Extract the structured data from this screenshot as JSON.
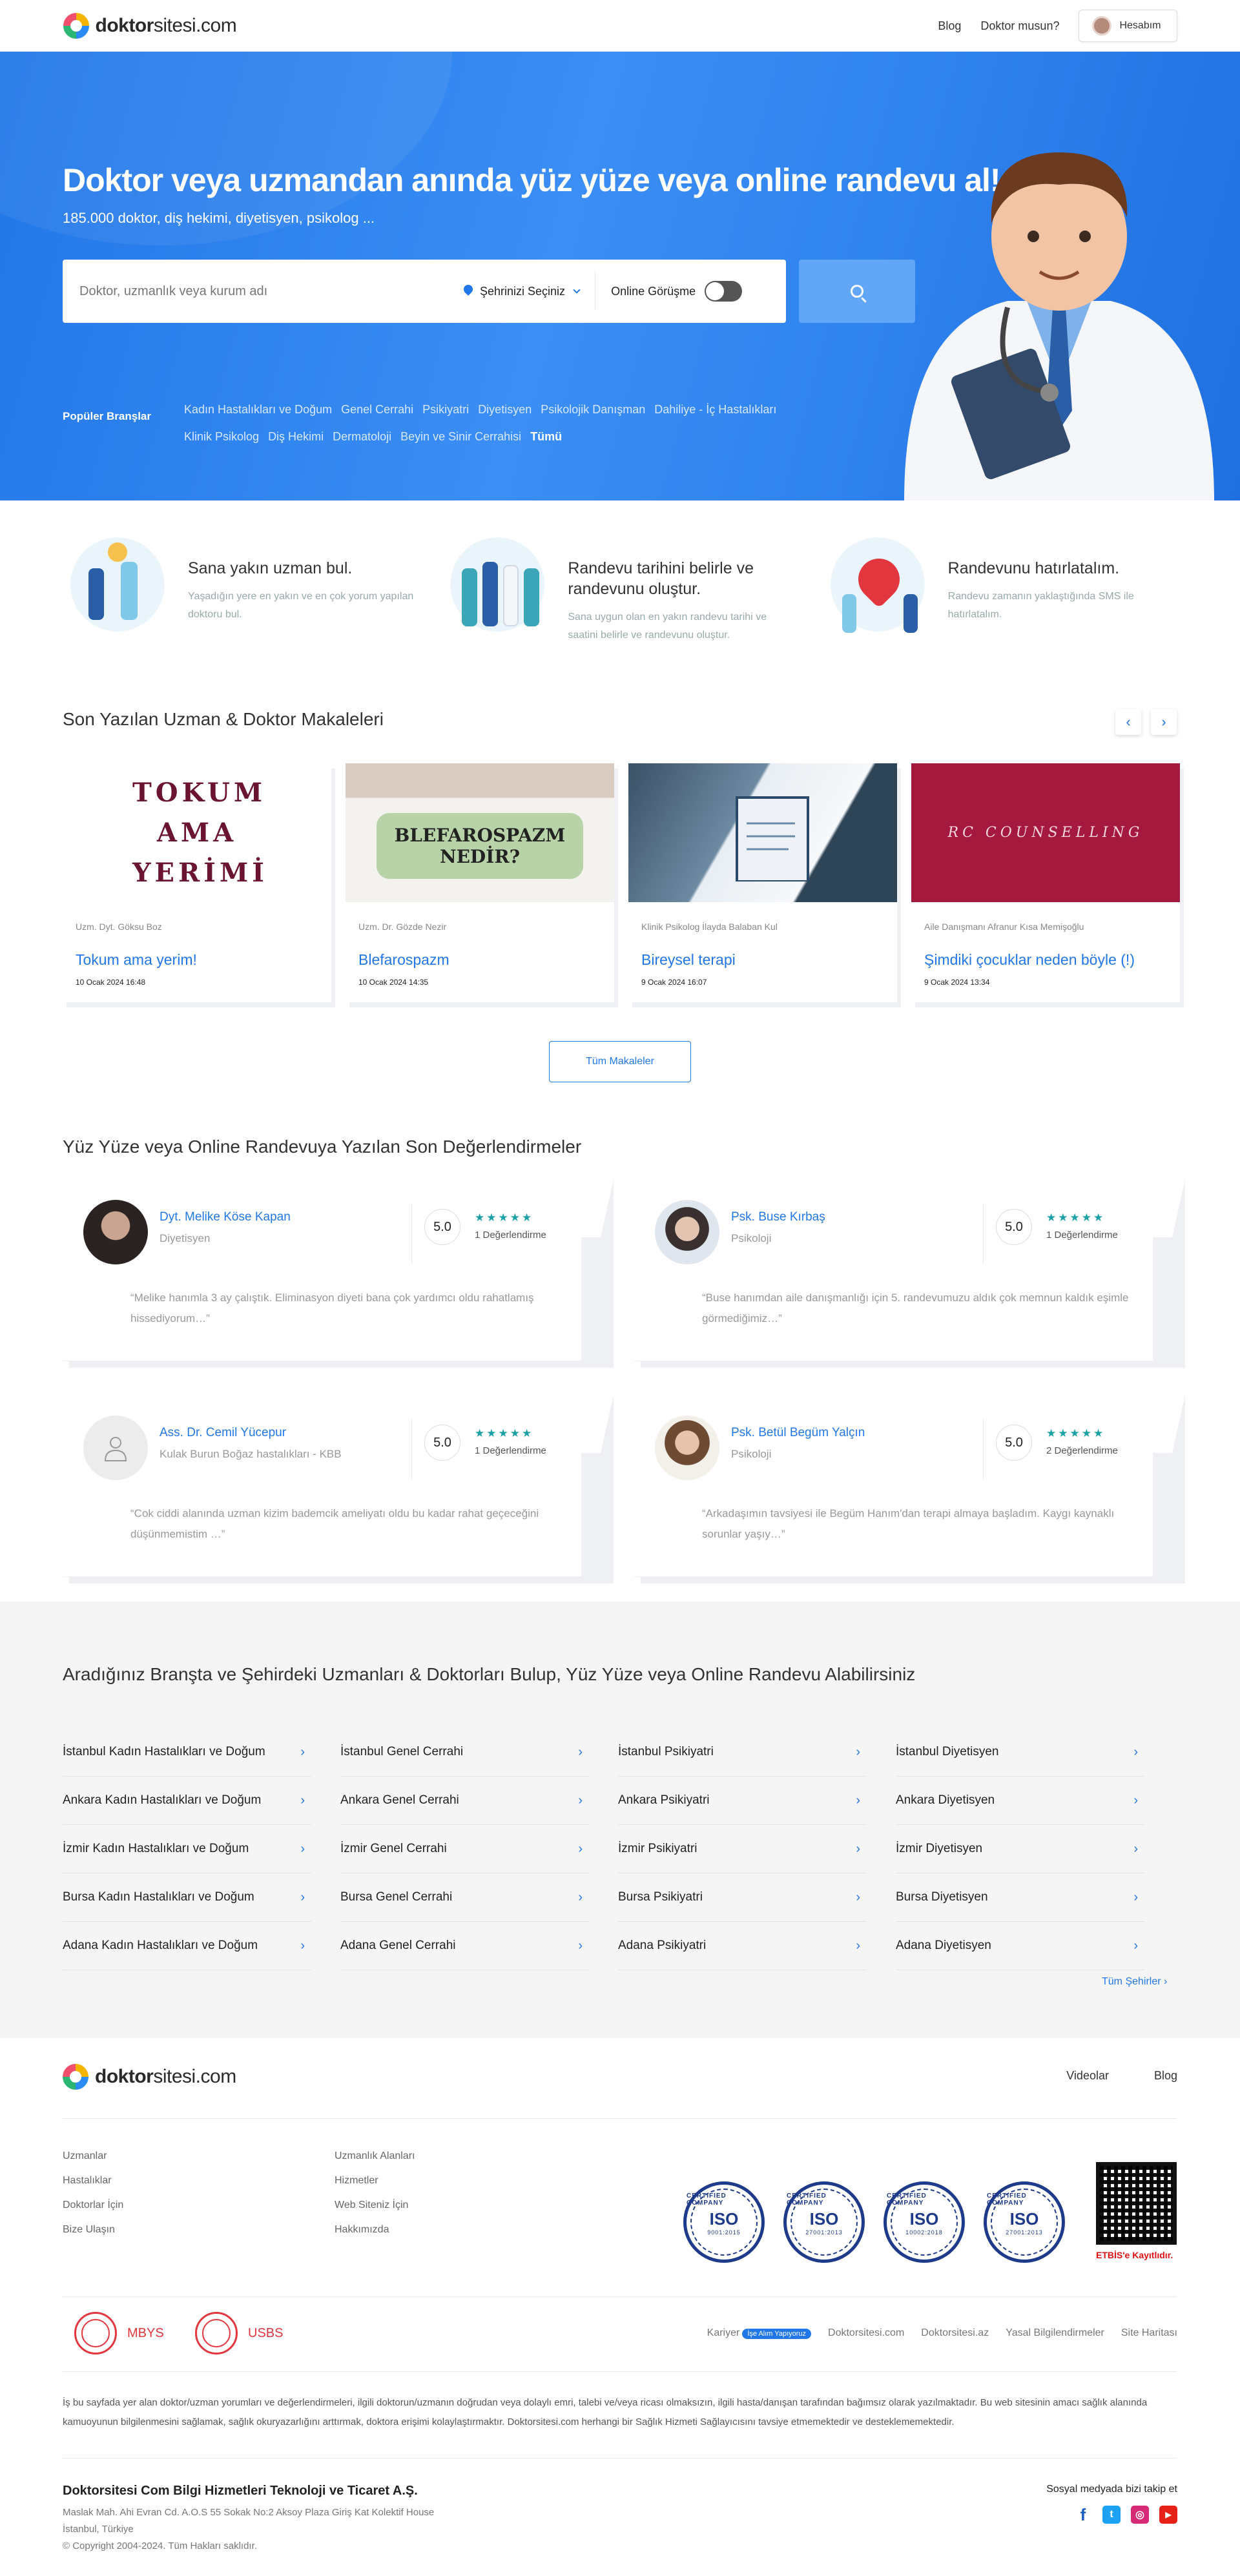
{
  "header": {
    "logo_bold": "doktor",
    "logo_rest": "sitesi.com",
    "nav": [
      "Blog",
      "Doktor musun?"
    ],
    "account_label": "Hesabım"
  },
  "hero": {
    "title": "Doktor veya uzmandan anında yüz yüze veya online randevu al!",
    "subtitle": "185.000 doktor, diş hekimi, diyetisyen, psikolog ...",
    "search_placeholder": "Doktor, uzmanlık veya kurum adı",
    "city_label": "Şehrinizi Seçiniz",
    "online_label": "Online Görüşme",
    "popular_label": "Popüler Branşlar",
    "branches": [
      "Kadın Hastalıkları ve Doğum",
      "Genel Cerrahi",
      "Psikiyatri",
      "Diyetisyen",
      "Psikolojik Danışman",
      "Dahiliye - İç Hastalıkları",
      "Klinik Psikolog",
      "Diş Hekimi",
      "Dermatoloji",
      "Beyin ve Sinir Cerrahisi"
    ],
    "branches_all": "Tümü"
  },
  "features": [
    {
      "title": "Sana yakın uzman bul.",
      "text": "Yaşadığın yere en yakın ve en çok yorum yapılan doktoru bul."
    },
    {
      "title": "Randevu tarihini belirle ve randevunu oluştur.",
      "text": "Sana uygun olan en yakın randevu tarihi ve saatini belirle ve randevunu oluştur."
    },
    {
      "title": "Randevunu hatırlatalım.",
      "text": "Randevu zamanın yaklaştığında SMS ile hatırlatalım."
    }
  ],
  "articles": {
    "title": "Son Yazılan Uzman & Doktor Makaleleri",
    "prev": "‹",
    "next": "›",
    "items": [
      {
        "author": "Uzm. Dyt. Göksu Boz",
        "title": "Tokum ama yerim!",
        "date": "10 Ocak 2024 16:48",
        "img_text": "TOKUM AMA YERİMİ"
      },
      {
        "author": "Uzm. Dr. Gözde Nezir",
        "title": "Blefarospazm",
        "date": "10 Ocak 2024 14:35",
        "img_text": "BLEFAROSPAZM NEDİR?"
      },
      {
        "author": "Klinik Psikolog İlayda Balaban Kul",
        "title": "Bireysel terapi",
        "date": "9 Ocak 2024 16:07",
        "img_text": ""
      },
      {
        "author": "Aile Danışmanı Afranur Kısa Memişoğlu",
        "title": "Şimdiki çocuklar neden böyle (!)",
        "date": "9 Ocak 2024 13:34",
        "img_text": "RC COUNSELLING"
      }
    ],
    "all_button": "Tüm Makaleler"
  },
  "reviews": {
    "title": "Yüz Yüze veya Online Randevuya Yazılan Son Değerlendirmeler",
    "items": [
      {
        "name": "Dyt. Melike Köse Kapan",
        "spec": "Diyetisyen",
        "score": "5.0",
        "stars": "★★★★★",
        "count": "1 Değerlendirme",
        "text": "“Melike hanımla 3 ay çalıştık. Eliminasyon diyeti bana çok yardımcı oldu rahatlamış hissediyorum…”"
      },
      {
        "name": "Psk. Buse Kırbaş",
        "spec": "Psikoloji",
        "score": "5.0",
        "stars": "★★★★★",
        "count": "1 Değerlendirme",
        "text": "“Buse hanımdan aile danışmanlığı için 5. randevumuzu aldık çok memnun kaldık eşimle görmediğimiz…”"
      },
      {
        "name": "Ass. Dr. Cemil Yücepur",
        "spec": "Kulak Burun Boğaz hastalıkları - KBB",
        "score": "5.0",
        "stars": "★★★★★",
        "count": "1 Değerlendirme",
        "text": "“Cok ciddi alanında uzman kizim bademcik ameliyatı oldu bu kadar rahat geçeceğini düşünmemistim …”"
      },
      {
        "name": "Psk. Betül Begüm Yalçın",
        "spec": "Psikoloji",
        "score": "5.0",
        "stars": "★★★★★",
        "count": "2 Değerlendirme",
        "text": "“Arkadaşımın tavsiyesi ile Begüm Hanım'dan terapi almaya başladım. Kaygı kaynaklı sorunlar yaşıy…”"
      }
    ]
  },
  "cities": {
    "title": "Aradığınız Branşta ve Şehirdeki Uzmanları & Doktorları Bulup, Yüz Yüze veya Online Randevu Alabilirsiniz",
    "columns": [
      [
        "İstanbul Kadın Hastalıkları ve Doğum",
        "Ankara Kadın Hastalıkları ve Doğum",
        "İzmir Kadın Hastalıkları ve Doğum",
        "Bursa Kadın Hastalıkları ve Doğum",
        "Adana Kadın Hastalıkları ve Doğum"
      ],
      [
        "İstanbul Genel Cerrahi",
        "Ankara Genel Cerrahi",
        "İzmir Genel Cerrahi",
        "Bursa Genel Cerrahi",
        "Adana Genel Cerrahi"
      ],
      [
        "İstanbul Psikiyatri",
        "Ankara Psikiyatri",
        "İzmir Psikiyatri",
        "Bursa Psikiyatri",
        "Adana Psikiyatri"
      ],
      [
        "İstanbul Diyetisyen",
        "Ankara Diyetisyen",
        "İzmir Diyetisyen",
        "Bursa Diyetisyen",
        "Adana Diyetisyen"
      ]
    ],
    "all_link": "Tüm Şehirler"
  },
  "footer": {
    "nav": [
      "Videolar",
      "Blog"
    ],
    "links_col1": [
      "Uzmanlar",
      "Hastalıklar",
      "Doktorlar İçin",
      "Bize Ulaşın"
    ],
    "links_col2": [
      "Uzmanlık Alanları",
      "Hizmetler",
      "Web Siteniz İçin",
      "Hakkımızda"
    ],
    "iso_label": "ISO",
    "iso_ring": "CERTIFIED COMPANY",
    "iso_codes": [
      "9001:2015",
      "27001:2013",
      "10002:2018",
      "27001:2013"
    ],
    "etbis": "ETBİS'e Kayıtlıdır.",
    "mbys": "MBYS",
    "usbs": "USBS",
    "bottom_links": [
      "Doktorsitesi.com",
      "Doktorsitesi.az",
      "Yasal Bilgilendirmeler",
      "Site Haritası"
    ],
    "career": "Kariyer",
    "career_badge": "İşe Alım Yapıyoruz",
    "disclaimer": "İş bu sayfada yer alan doktor/uzman yorumları ve değerlendirmeleri, ilgili doktorun/uzmanın doğrudan veya dolaylı emri, talebi ve/veya ricası olmaksızın, ilgili hasta/danışan tarafından bağımsız olarak yazılmaktadır. Bu web sitesinin amacı sağlık alanında kamuoyunun bilgilenmesini sağlamak, sağlık okuryazarlığını arttırmak, doktora erişimi kolaylaştırmaktır. Doktorsitesi.com herhangi bir Sağlık Hizmeti Sağlayıcısını tavsiye etmemektedir ve desteklememektedir.",
    "company": "Doktorsitesi Com Bilgi Hizmetleri Teknoloji ve Ticaret A.Ş.",
    "address1": "Maslak Mah. Ahi Evran Cd. A.O.S 55 Sokak No:2 Aksoy Plaza Giriş Kat Kolektif House",
    "address2": "İstanbul, Türkiye",
    "copyright": "© Copyright 2004-2024. Tüm Hakları saklıdır.",
    "social_title": "Sosyal medyada bizi takip et",
    "social": [
      "f",
      "t",
      "◎",
      "▶"
    ]
  },
  "colors": {
    "accent": "#2277e8",
    "hero": "#3b8ef4",
    "rating": "#1aa0a6"
  }
}
